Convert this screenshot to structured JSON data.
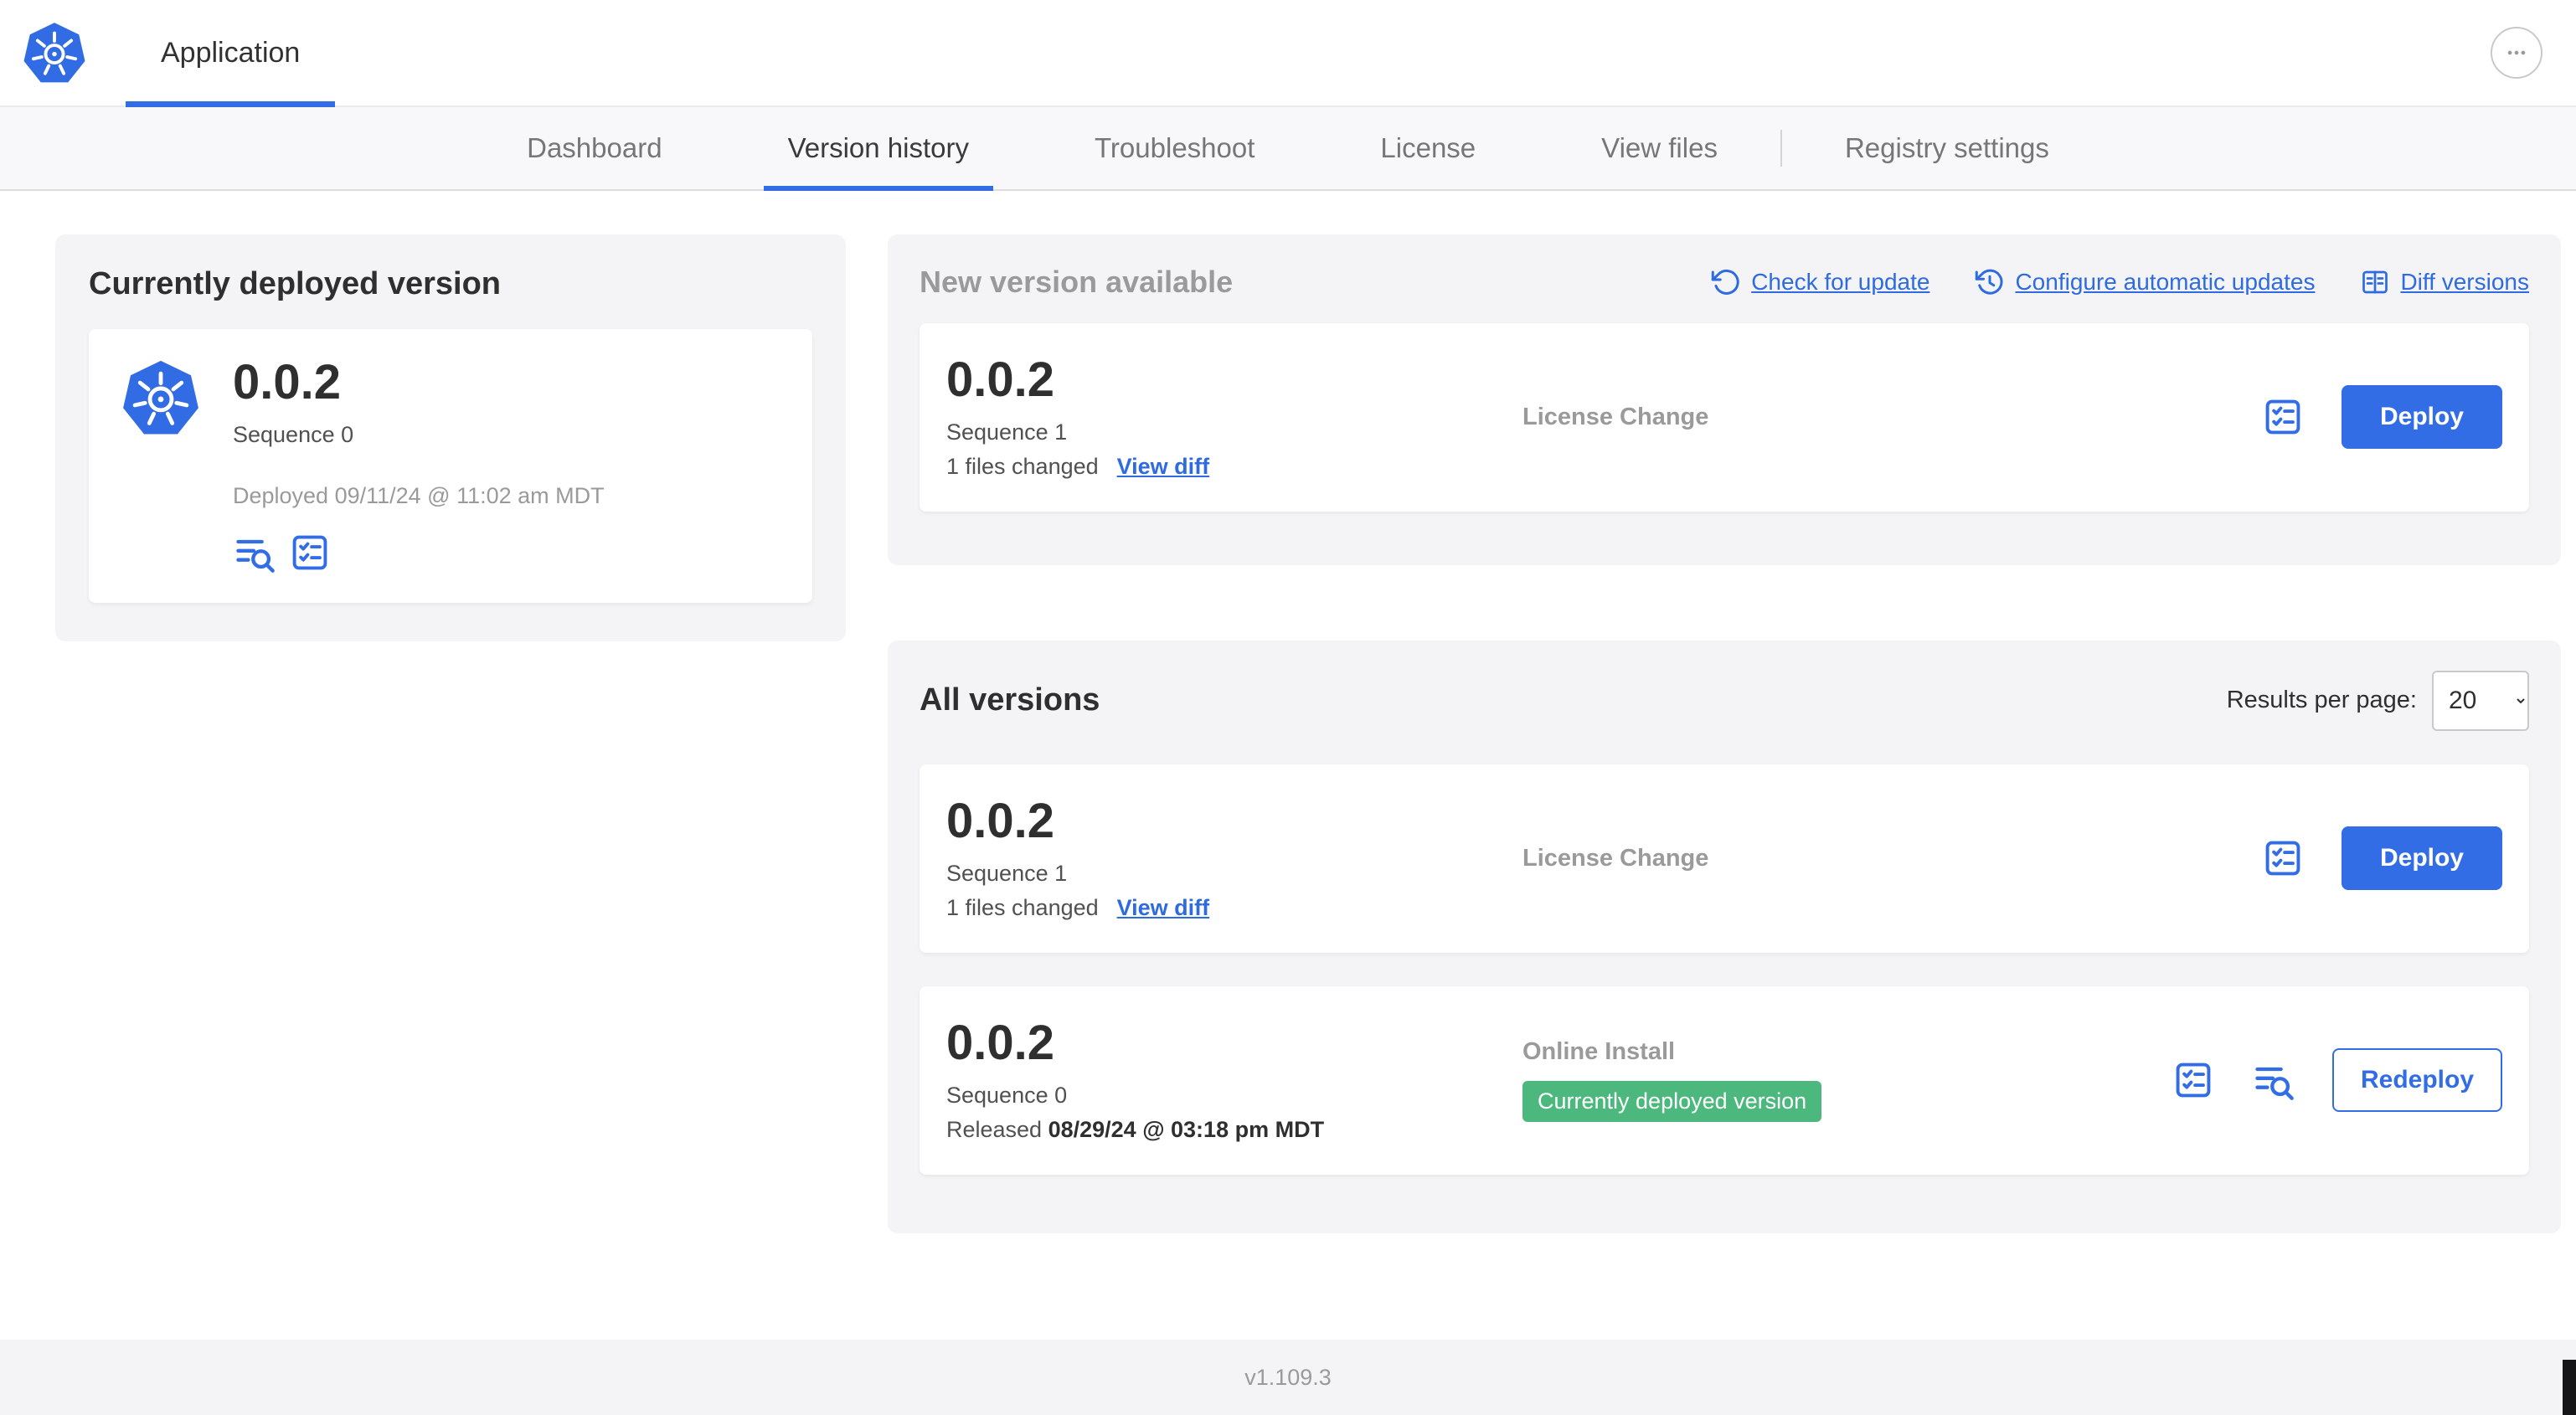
{
  "header": {
    "app_title": "Application"
  },
  "nav": {
    "tabs": [
      {
        "label": "Dashboard",
        "active": false
      },
      {
        "label": "Version history",
        "active": true
      },
      {
        "label": "Troubleshoot",
        "active": false
      },
      {
        "label": "License",
        "active": false
      },
      {
        "label": "View files",
        "active": false
      },
      {
        "label": "Registry settings",
        "active": false
      }
    ]
  },
  "current_version": {
    "title": "Currently deployed version",
    "version": "0.0.2",
    "sequence": "Sequence 0",
    "deployed_at": "Deployed 09/11/24 @ 11:02 am MDT"
  },
  "new_version": {
    "title": "New version available",
    "check_for_update": "Check for update",
    "configure_auto_updates": "Configure automatic updates",
    "diff_versions": "Diff versions",
    "row": {
      "version": "0.0.2",
      "sequence": "Sequence 1",
      "files_changed": "1 files changed",
      "view_diff": "View diff",
      "source": "License Change",
      "action": "Deploy"
    }
  },
  "all_versions": {
    "title": "All versions",
    "results_per_page_label": "Results per page:",
    "results_per_page_value": "20",
    "rows": [
      {
        "version": "0.0.2",
        "sequence": "Sequence 1",
        "files_changed": "1 files changed",
        "view_diff": "View diff",
        "source": "License Change",
        "action": "Deploy"
      },
      {
        "version": "0.0.2",
        "sequence": "Sequence 0",
        "released_label": "Released",
        "released_date": "08/29/24 @ 03:18 pm MDT",
        "source": "Online Install",
        "badge": "Currently deployed version",
        "action": "Redeploy"
      }
    ]
  },
  "footer": {
    "app_version": "v1.109.3"
  },
  "colors": {
    "accent_blue": "#326de6",
    "link_blue": "#2e6be0",
    "badge_green": "#4db87e",
    "card_gray": "#f4f4f6",
    "muted_gray": "#9a9a9a"
  },
  "icons": {
    "logo": "kubernetes-helm-wheel",
    "more": "ellipsis",
    "check_for_update": "rotate-ccw-arrow",
    "configure_auto_updates": "clock-history",
    "diff_versions": "split-table-diff",
    "release_notes": "text-lines-magnifier",
    "preflight_checks": "checklist"
  }
}
